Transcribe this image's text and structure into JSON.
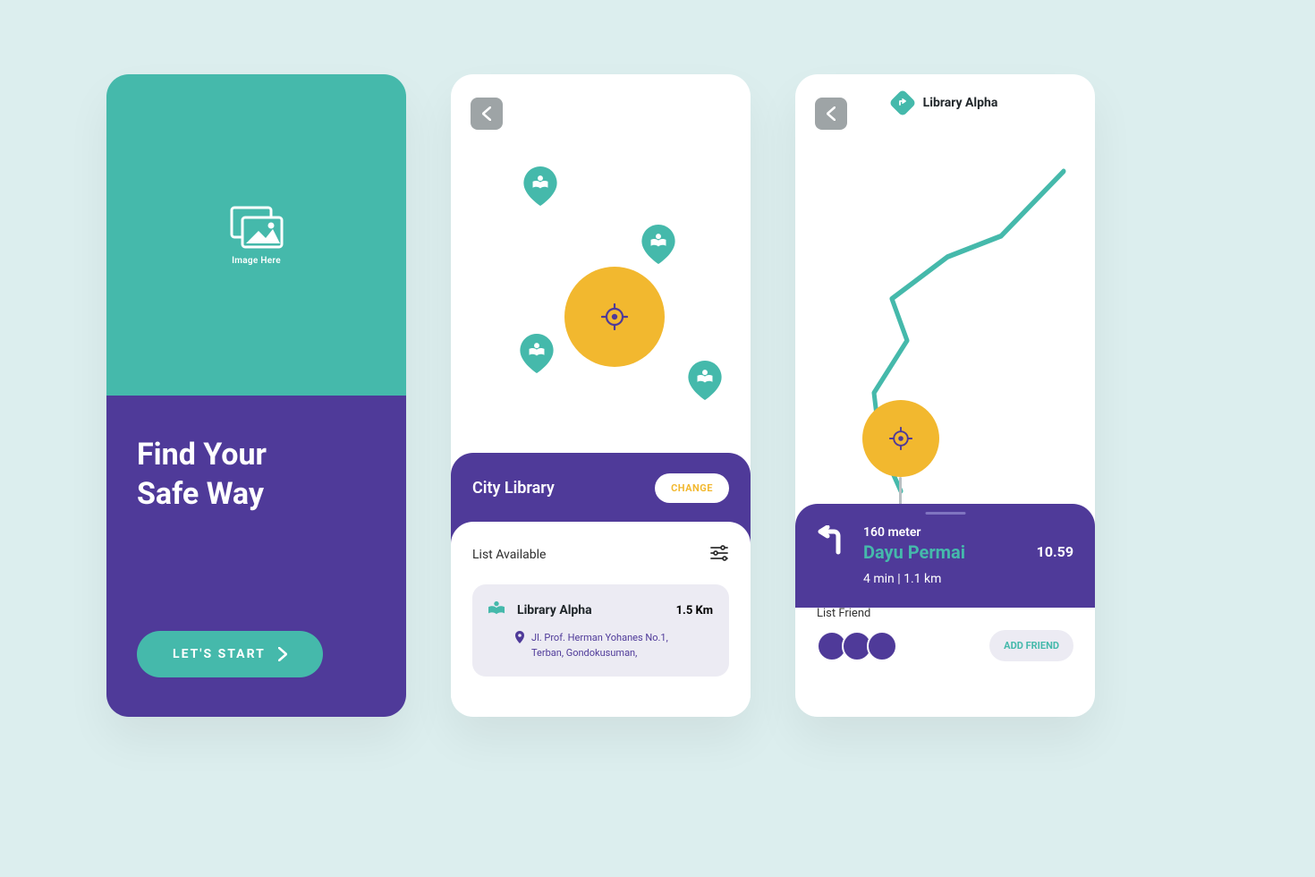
{
  "colors": {
    "teal": "#45b9ab",
    "purple": "#4f3a99",
    "yellow": "#f2b82f",
    "bg": "#dceeee"
  },
  "screen1": {
    "image_placeholder": "Image Here",
    "headline_l1": "Find Your",
    "headline_l2": "Safe Way",
    "cta": "LET'S START"
  },
  "screen2": {
    "category_title": "City Library",
    "change_label": "CHANGE",
    "list_label": "List Available",
    "item": {
      "name": "Library Alpha",
      "distance": "1.5 Km",
      "address_l1": "Jl. Prof. Herman Yohanes No.1,",
      "address_l2": "Terban, Gondokusuman,"
    }
  },
  "screen3": {
    "title": "Library Alpha",
    "nav": {
      "distance": "160 meter",
      "street": "Dayu Permai",
      "clock": "10.59",
      "eta": "4 min | 1.1 km"
    },
    "friend_label": "List Friend",
    "friend_count": 3,
    "add_friend": "ADD FRIEND"
  }
}
